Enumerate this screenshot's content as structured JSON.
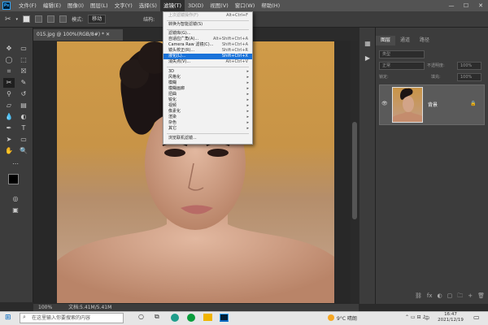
{
  "menubar": {
    "app_icon": "Ps",
    "items": [
      "文件(F)",
      "编辑(E)",
      "图像(I)",
      "图层(L)",
      "文字(Y)",
      "选择(S)",
      "滤镜(T)",
      "3D(D)",
      "视图(V)",
      "窗口(W)",
      "帮助(H)"
    ],
    "active_index": 6
  },
  "window_controls": {
    "minimize": "—",
    "maximize": "☐",
    "close": "✕"
  },
  "options": {
    "mode_label": "模式:",
    "mode_value": "移动",
    "structure_label": "结构:"
  },
  "document": {
    "tab_label": "015.jpg @ 100%(RGB/8#) *",
    "zoom": "100%",
    "doc_info": "文档:5.41M/5.41M"
  },
  "filter_menu": {
    "items": [
      {
        "label": "上次滤镜操作(F)",
        "shortcut": "Alt+Ctrl+F",
        "disabled": true
      },
      {
        "label": "转换为智能滤镜(S)",
        "shortcut": ""
      },
      {
        "label": "滤镜库(G)...",
        "shortcut": ""
      },
      {
        "label": "自适应广角(A)...",
        "shortcut": "Alt+Shift+Ctrl+A"
      },
      {
        "label": "Camera Raw 滤镜(C)...",
        "shortcut": "Shift+Ctrl+A"
      },
      {
        "label": "镜头校正(R)...",
        "shortcut": "Shift+Ctrl+R"
      },
      {
        "label": "液化(L)...",
        "shortcut": "Shift+Ctrl+X",
        "highlighted": true
      },
      {
        "label": "消失点(V)...",
        "shortcut": "Alt+Ctrl+V"
      },
      {
        "label": "3D",
        "submenu": true
      },
      {
        "label": "风格化",
        "submenu": true
      },
      {
        "label": "模糊",
        "submenu": true
      },
      {
        "label": "模糊画廊",
        "submenu": true
      },
      {
        "label": "扭曲",
        "submenu": true
      },
      {
        "label": "锐化",
        "submenu": true
      },
      {
        "label": "视频",
        "submenu": true
      },
      {
        "label": "像素化",
        "submenu": true
      },
      {
        "label": "渲染",
        "submenu": true
      },
      {
        "label": "杂色",
        "submenu": true
      },
      {
        "label": "其它",
        "submenu": true
      },
      {
        "label": "浏览联机滤镜...",
        "shortcut": ""
      }
    ],
    "submenu_arrow": "▸"
  },
  "layers_panel": {
    "tabs": [
      "图层",
      "通道",
      "路径"
    ],
    "kind_placeholder": "类型",
    "blend_mode": "正常",
    "opacity_label": "不透明度:",
    "opacity": "100%",
    "lock_label": "锁定:",
    "fill_label": "填充:",
    "fill": "100%",
    "layer_name": "背景",
    "eye": "👁",
    "lock": "🔒",
    "bottom_icons": [
      "⛓",
      "fx",
      "◐",
      "▢",
      "🗀",
      "+",
      "🗑"
    ]
  },
  "taskbar": {
    "search_placeholder": "在这里输入你要搜索的内容",
    "weather": "9°C 晴朗",
    "ime": "中",
    "time": "16:47",
    "date": "2021/12/19"
  }
}
